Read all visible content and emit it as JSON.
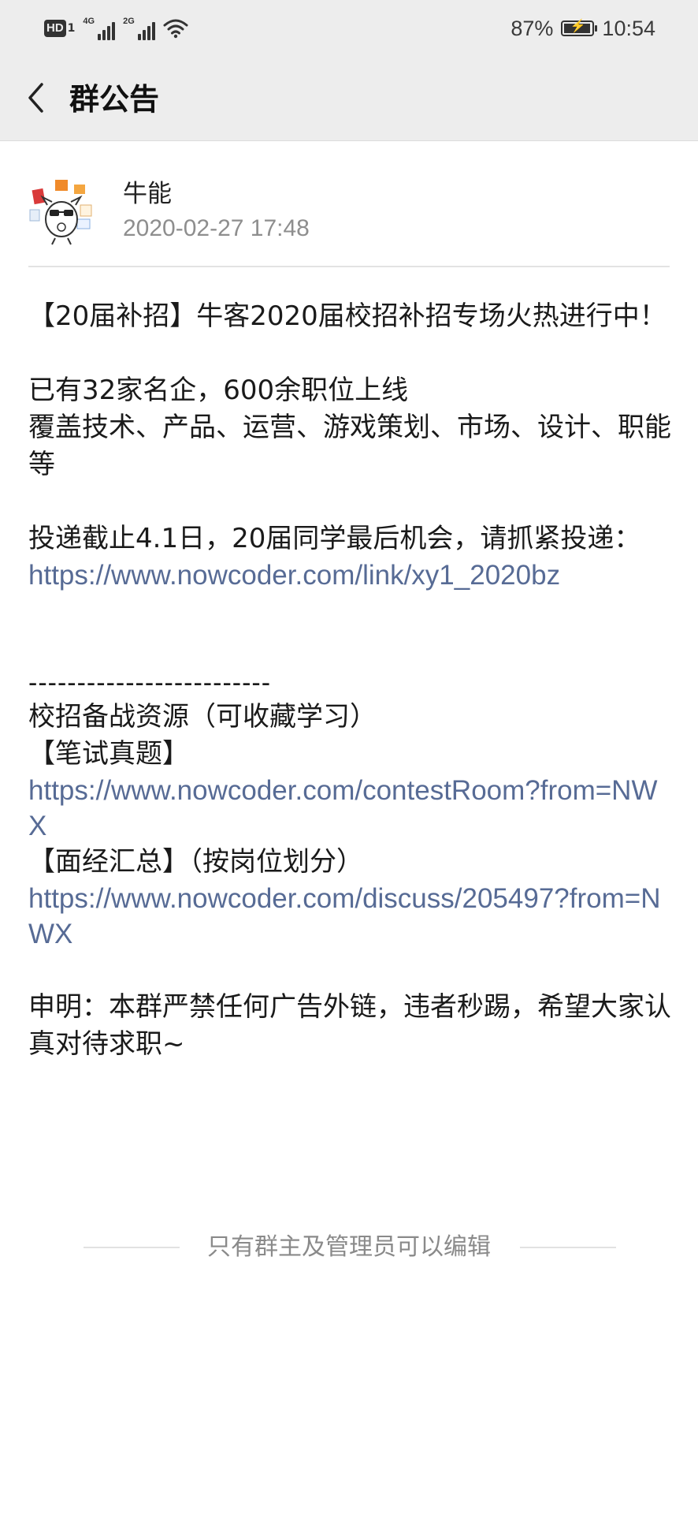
{
  "status_bar": {
    "network_badge": "HD",
    "network_badge_sub": "1",
    "signal1_label": "4G",
    "signal2_label": "2G",
    "battery_percent": "87%",
    "time": "10:54",
    "battery_level": 0.87
  },
  "nav": {
    "back_icon": "chevron-left-icon",
    "title": "群公告"
  },
  "author": {
    "name": "牛能",
    "timestamp": "2020-02-27 17:48"
  },
  "announcement": {
    "para1": "【20届补招】牛客2020届校招补招专场火热进行中！",
    "para2_line1": "已有32家名企，600余职位上线",
    "para2_line2": "覆盖技术、产品、运营、游戏策划、市场、设计、职能等",
    "para3": "投递截止4.1日，20届同学最后机会，请抓紧投递：",
    "link1": "https://www.nowcoder.com/link/xy1_2020bz",
    "separator": "-------------------------",
    "resources_title": "校招备战资源（可收藏学习）",
    "written_test_label": "【笔试真题】",
    "link2": "https://www.nowcoder.com/contestRoom?from=NWX",
    "interview_label": "【面经汇总】（按岗位划分）",
    "link3": "https://www.nowcoder.com/discuss/205497?from=NWX",
    "declaration": "申明：本群严禁任何广告外链，违者秒踢，希望大家认真对待求职~"
  },
  "footer": {
    "note": "只有群主及管理员可以编辑"
  },
  "colors": {
    "header_bg": "#ededed",
    "link": "#576b95",
    "muted": "#8e8e8e"
  }
}
